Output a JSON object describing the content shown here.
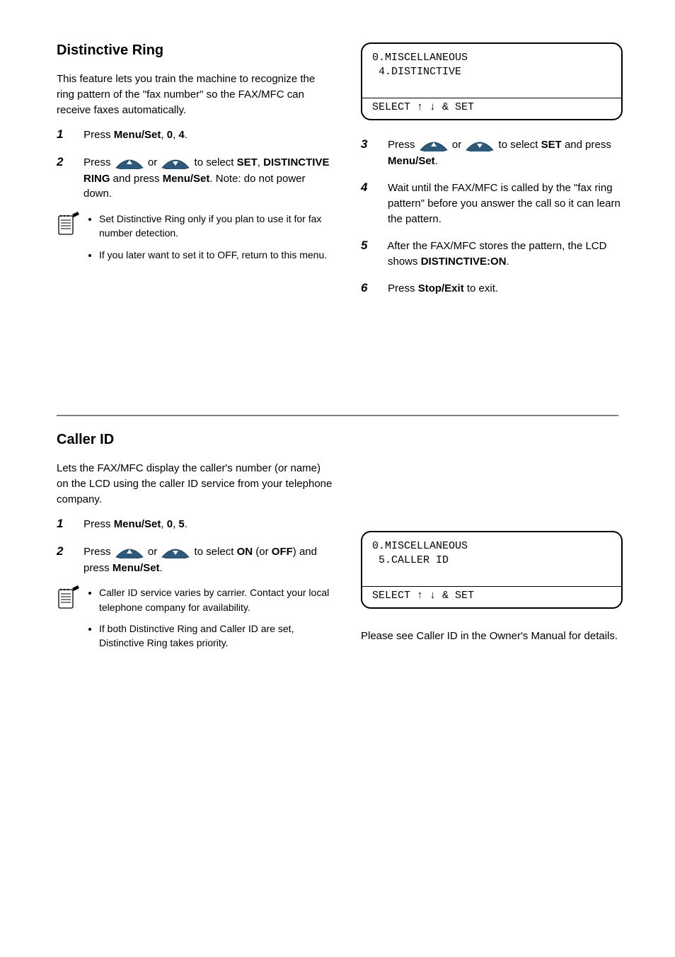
{
  "section1": {
    "left": {
      "title": "Distinctive Ring",
      "intro": "This feature lets you train the machine to recognize the ring pattern of the \"fax number\" so the FAX/MFC can receive faxes automatically.",
      "step1_a": "Press",
      "step1_b": ",",
      "step1_c": ".",
      "step2_a": "Press",
      "step2_b": "or",
      "step2_c": "to select",
      "step2_set": "SET",
      "step2_d": ",",
      "step2_dr": "DISTINCTIVE RING",
      "step2_e": "and press",
      "step2_menu": "Menu/Set",
      "step2_f": ". Note: do not power down.",
      "notes": [
        "Set Distinctive Ring only if you plan to use it for fax number detection.",
        "If you later want to set it to OFF, return to this menu."
      ],
      "keys": {
        "menu": "Menu/Set",
        "zero": "0",
        "four": "4"
      }
    },
    "right": {
      "lcd_body": "0.MISCELLANEOUS\n 4.DISTINCTIVE   ",
      "lcd_prompt": "SELECT ↑ ↓ & SET",
      "step3_a": "Press",
      "step3_b": "or",
      "step3_c": "to select",
      "step3_set": "SET",
      "step3_d": "and press",
      "step3_menu": "Menu/Set",
      "step3_e": ".",
      "step4_a": "Wait until the FAX/MFC is called by the \"fax ring pattern\" before you answer the call so it can learn the pattern.",
      "step5_a": "After the FAX/MFC stores the pattern, the LCD shows",
      "step5_dron": "DISTINCTIVE:ON",
      "step5_b": ".",
      "step6_a": "Press",
      "step6_stop": "Stop/Exit",
      "step6_b": "to exit."
    }
  },
  "section2": {
    "left": {
      "title": "Caller ID",
      "intro": "Lets the FAX/MFC display the caller's number (or name) on the LCD using the caller ID service from your telephone company.",
      "step1_a": "Press",
      "step1_b": ",",
      "step1_c": ".",
      "step2_a": "Press",
      "step2_b": "or",
      "step2_c": "to select",
      "step2_on": "ON",
      "step2_or": "(or",
      "step2_off": "OFF",
      "step2_close": ") and press",
      "step2_menu": "Menu/Set",
      "step2_d": ".",
      "notes": [
        "Caller ID service varies by carrier. Contact your local telephone company for availability.",
        "If both Distinctive Ring and Caller ID are set, Distinctive Ring takes priority."
      ],
      "keys": {
        "menu": "Menu/Set",
        "zero": "0",
        "five": "5"
      }
    },
    "right": {
      "lcd_body": "0.MISCELLANEOUS\n 5.CALLER ID    ",
      "lcd_prompt": "SELECT ↑ ↓ & SET",
      "foot": "Please see Caller ID in the Owner's Manual for details."
    }
  }
}
